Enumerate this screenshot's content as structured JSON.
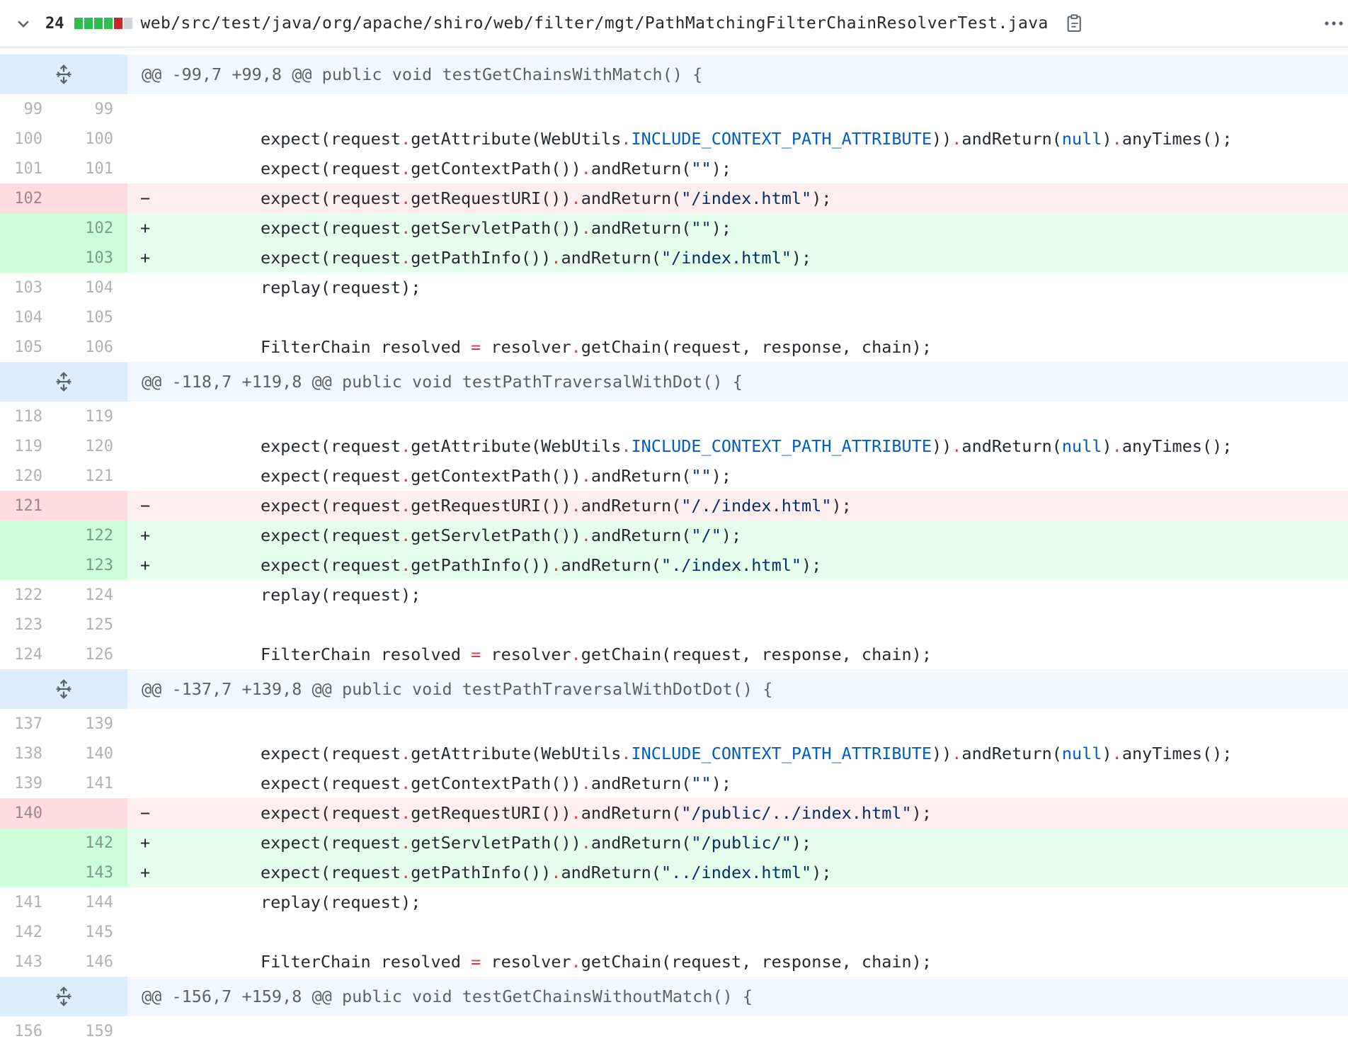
{
  "file": {
    "changes_count": "24",
    "path": "web/src/test/java/org/apache/shiro/web/filter/mgt/PathMatchingFilterChainResolverTest.java",
    "diffstat_blocks": [
      "#2cbe4e",
      "#2cbe4e",
      "#2cbe4e",
      "#2cbe4e",
      "#cb2431",
      "#d1d5da"
    ]
  },
  "hunks": [
    {
      "header": "@@ -99,7 +99,8 @@ public void testGetChainsWithMatch() {",
      "rows": [
        {
          "type": "ctx",
          "old": "99",
          "new": "99",
          "sign": "",
          "tokens": []
        },
        {
          "type": "ctx",
          "old": "100",
          "new": "100",
          "sign": "",
          "tokens": [
            [
              "k",
              "expect(request"
            ],
            [
              "op",
              "."
            ],
            [
              "k",
              "getAttribute(WebUtils"
            ],
            [
              "op",
              "."
            ],
            [
              "cst",
              "INCLUDE_CONTEXT_PATH_ATTRIBUTE"
            ],
            [
              "k",
              "))"
            ],
            [
              "op",
              "."
            ],
            [
              "k",
              "andReturn("
            ],
            [
              "cst",
              "null"
            ],
            [
              "k",
              ")"
            ],
            [
              "op",
              "."
            ],
            [
              "k",
              "anyTimes();"
            ]
          ]
        },
        {
          "type": "ctx",
          "old": "101",
          "new": "101",
          "sign": "",
          "tokens": [
            [
              "k",
              "expect(request"
            ],
            [
              "op",
              "."
            ],
            [
              "k",
              "getContextPath())"
            ],
            [
              "op",
              "."
            ],
            [
              "k",
              "andReturn("
            ],
            [
              "str",
              "\"\""
            ],
            [
              "k",
              ");"
            ]
          ]
        },
        {
          "type": "del",
          "old": "102",
          "new": "",
          "sign": "−",
          "tokens": [
            [
              "k",
              "expect(request"
            ],
            [
              "op",
              "."
            ],
            [
              "k",
              "getRequestURI())"
            ],
            [
              "op",
              "."
            ],
            [
              "k",
              "andReturn("
            ],
            [
              "str",
              "\"/index.html\""
            ],
            [
              "k",
              ");"
            ]
          ]
        },
        {
          "type": "add",
          "old": "",
          "new": "102",
          "sign": "+",
          "tokens": [
            [
              "k",
              "expect(request"
            ],
            [
              "op",
              "."
            ],
            [
              "k",
              "getServletPath())"
            ],
            [
              "op",
              "."
            ],
            [
              "k",
              "andReturn("
            ],
            [
              "str",
              "\"\""
            ],
            [
              "k",
              ");"
            ]
          ]
        },
        {
          "type": "add",
          "old": "",
          "new": "103",
          "sign": "+",
          "tokens": [
            [
              "k",
              "expect(request"
            ],
            [
              "op",
              "."
            ],
            [
              "k",
              "getPathInfo())"
            ],
            [
              "op",
              "."
            ],
            [
              "k",
              "andReturn("
            ],
            [
              "str",
              "\"/index.html\""
            ],
            [
              "k",
              ");"
            ]
          ]
        },
        {
          "type": "ctx",
          "old": "103",
          "new": "104",
          "sign": "",
          "tokens": [
            [
              "k",
              "replay(request);"
            ]
          ]
        },
        {
          "type": "ctx",
          "old": "104",
          "new": "105",
          "sign": "",
          "tokens": []
        },
        {
          "type": "ctx",
          "old": "105",
          "new": "106",
          "sign": "",
          "tokens": [
            [
              "k",
              "FilterChain resolved "
            ],
            [
              "op",
              "="
            ],
            [
              "k",
              " resolver"
            ],
            [
              "op",
              "."
            ],
            [
              "k",
              "getChain(request, response, chain);"
            ]
          ]
        }
      ]
    },
    {
      "header": "@@ -118,7 +119,8 @@ public void testPathTraversalWithDot() {",
      "rows": [
        {
          "type": "ctx",
          "old": "118",
          "new": "119",
          "sign": "",
          "tokens": []
        },
        {
          "type": "ctx",
          "old": "119",
          "new": "120",
          "sign": "",
          "tokens": [
            [
              "k",
              "expect(request"
            ],
            [
              "op",
              "."
            ],
            [
              "k",
              "getAttribute(WebUtils"
            ],
            [
              "op",
              "."
            ],
            [
              "cst",
              "INCLUDE_CONTEXT_PATH_ATTRIBUTE"
            ],
            [
              "k",
              "))"
            ],
            [
              "op",
              "."
            ],
            [
              "k",
              "andReturn("
            ],
            [
              "cst",
              "null"
            ],
            [
              "k",
              ")"
            ],
            [
              "op",
              "."
            ],
            [
              "k",
              "anyTimes();"
            ]
          ]
        },
        {
          "type": "ctx",
          "old": "120",
          "new": "121",
          "sign": "",
          "tokens": [
            [
              "k",
              "expect(request"
            ],
            [
              "op",
              "."
            ],
            [
              "k",
              "getContextPath())"
            ],
            [
              "op",
              "."
            ],
            [
              "k",
              "andReturn("
            ],
            [
              "str",
              "\"\""
            ],
            [
              "k",
              ");"
            ]
          ]
        },
        {
          "type": "del",
          "old": "121",
          "new": "",
          "sign": "−",
          "tokens": [
            [
              "k",
              "expect(request"
            ],
            [
              "op",
              "."
            ],
            [
              "k",
              "getRequestURI())"
            ],
            [
              "op",
              "."
            ],
            [
              "k",
              "andReturn("
            ],
            [
              "str",
              "\"/./index.html\""
            ],
            [
              "k",
              ");"
            ]
          ]
        },
        {
          "type": "add",
          "old": "",
          "new": "122",
          "sign": "+",
          "tokens": [
            [
              "k",
              "expect(request"
            ],
            [
              "op",
              "."
            ],
            [
              "k",
              "getServletPath())"
            ],
            [
              "op",
              "."
            ],
            [
              "k",
              "andReturn("
            ],
            [
              "str",
              "\"/\""
            ],
            [
              "k",
              ");"
            ]
          ]
        },
        {
          "type": "add",
          "old": "",
          "new": "123",
          "sign": "+",
          "tokens": [
            [
              "k",
              "expect(request"
            ],
            [
              "op",
              "."
            ],
            [
              "k",
              "getPathInfo())"
            ],
            [
              "op",
              "."
            ],
            [
              "k",
              "andReturn("
            ],
            [
              "str",
              "\"./index.html\""
            ],
            [
              "k",
              ");"
            ]
          ]
        },
        {
          "type": "ctx",
          "old": "122",
          "new": "124",
          "sign": "",
          "tokens": [
            [
              "k",
              "replay(request);"
            ]
          ]
        },
        {
          "type": "ctx",
          "old": "123",
          "new": "125",
          "sign": "",
          "tokens": []
        },
        {
          "type": "ctx",
          "old": "124",
          "new": "126",
          "sign": "",
          "tokens": [
            [
              "k",
              "FilterChain resolved "
            ],
            [
              "op",
              "="
            ],
            [
              "k",
              " resolver"
            ],
            [
              "op",
              "."
            ],
            [
              "k",
              "getChain(request, response, chain);"
            ]
          ]
        }
      ]
    },
    {
      "header": "@@ -137,7 +139,8 @@ public void testPathTraversalWithDotDot() {",
      "rows": [
        {
          "type": "ctx",
          "old": "137",
          "new": "139",
          "sign": "",
          "tokens": []
        },
        {
          "type": "ctx",
          "old": "138",
          "new": "140",
          "sign": "",
          "tokens": [
            [
              "k",
              "expect(request"
            ],
            [
              "op",
              "."
            ],
            [
              "k",
              "getAttribute(WebUtils"
            ],
            [
              "op",
              "."
            ],
            [
              "cst",
              "INCLUDE_CONTEXT_PATH_ATTRIBUTE"
            ],
            [
              "k",
              "))"
            ],
            [
              "op",
              "."
            ],
            [
              "k",
              "andReturn("
            ],
            [
              "cst",
              "null"
            ],
            [
              "k",
              ")"
            ],
            [
              "op",
              "."
            ],
            [
              "k",
              "anyTimes();"
            ]
          ]
        },
        {
          "type": "ctx",
          "old": "139",
          "new": "141",
          "sign": "",
          "tokens": [
            [
              "k",
              "expect(request"
            ],
            [
              "op",
              "."
            ],
            [
              "k",
              "getContextPath())"
            ],
            [
              "op",
              "."
            ],
            [
              "k",
              "andReturn("
            ],
            [
              "str",
              "\"\""
            ],
            [
              "k",
              ");"
            ]
          ]
        },
        {
          "type": "del",
          "old": "140",
          "new": "",
          "sign": "−",
          "tokens": [
            [
              "k",
              "expect(request"
            ],
            [
              "op",
              "."
            ],
            [
              "k",
              "getRequestURI())"
            ],
            [
              "op",
              "."
            ],
            [
              "k",
              "andReturn("
            ],
            [
              "str",
              "\"/public/../index.html\""
            ],
            [
              "k",
              ");"
            ]
          ]
        },
        {
          "type": "add",
          "old": "",
          "new": "142",
          "sign": "+",
          "tokens": [
            [
              "k",
              "expect(request"
            ],
            [
              "op",
              "."
            ],
            [
              "k",
              "getServletPath())"
            ],
            [
              "op",
              "."
            ],
            [
              "k",
              "andReturn("
            ],
            [
              "str",
              "\"/public/\""
            ],
            [
              "k",
              ");"
            ]
          ]
        },
        {
          "type": "add",
          "old": "",
          "new": "143",
          "sign": "+",
          "tokens": [
            [
              "k",
              "expect(request"
            ],
            [
              "op",
              "."
            ],
            [
              "k",
              "getPathInfo())"
            ],
            [
              "op",
              "."
            ],
            [
              "k",
              "andReturn("
            ],
            [
              "str",
              "\"../index.html\""
            ],
            [
              "k",
              ");"
            ]
          ]
        },
        {
          "type": "ctx",
          "old": "141",
          "new": "144",
          "sign": "",
          "tokens": [
            [
              "k",
              "replay(request);"
            ]
          ]
        },
        {
          "type": "ctx",
          "old": "142",
          "new": "145",
          "sign": "",
          "tokens": []
        },
        {
          "type": "ctx",
          "old": "143",
          "new": "146",
          "sign": "",
          "tokens": [
            [
              "k",
              "FilterChain resolved "
            ],
            [
              "op",
              "="
            ],
            [
              "k",
              " resolver"
            ],
            [
              "op",
              "."
            ],
            [
              "k",
              "getChain(request, response, chain);"
            ]
          ]
        }
      ]
    },
    {
      "header": "@@ -156,7 +159,8 @@ public void testGetChainsWithoutMatch() {",
      "rows": [
        {
          "type": "ctx",
          "old": "156",
          "new": "159",
          "sign": "",
          "tokens": []
        }
      ]
    }
  ],
  "icons": {
    "collapse": "chevron-down-icon",
    "copy": "copy-path-icon",
    "more": "kebab-menu-icon",
    "expand": "expand-lines-icon"
  }
}
